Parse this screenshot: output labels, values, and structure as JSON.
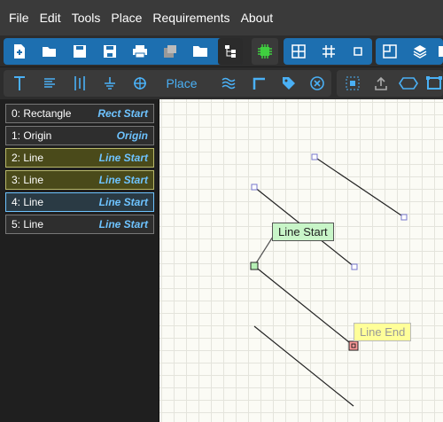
{
  "menu": [
    "File",
    "Edit",
    "Tools",
    "Place",
    "Requirements",
    "About"
  ],
  "toolbar2": {
    "place_label": "Place"
  },
  "operations": [
    {
      "label": "0: Rectangle",
      "type": "Rect Start",
      "state": "normal"
    },
    {
      "label": "1: Origin",
      "type": "Origin",
      "state": "normal"
    },
    {
      "label": "2: Line",
      "type": "Line Start",
      "state": "highlighted"
    },
    {
      "label": "3: Line",
      "type": "Line Start",
      "state": "highlighted"
    },
    {
      "label": "4: Line",
      "type": "Line Start",
      "state": "selected"
    },
    {
      "label": "5: Line",
      "type": "Line Start",
      "state": "normal"
    }
  ],
  "canvas": {
    "start_label": "Line Start",
    "end_label": "Line End"
  },
  "colors": {
    "accent_blue": "#1d6fb0",
    "highlight_green": "#c8f5c8",
    "highlight_yellow": "#ffff99",
    "end_marker": "#ff9999"
  }
}
